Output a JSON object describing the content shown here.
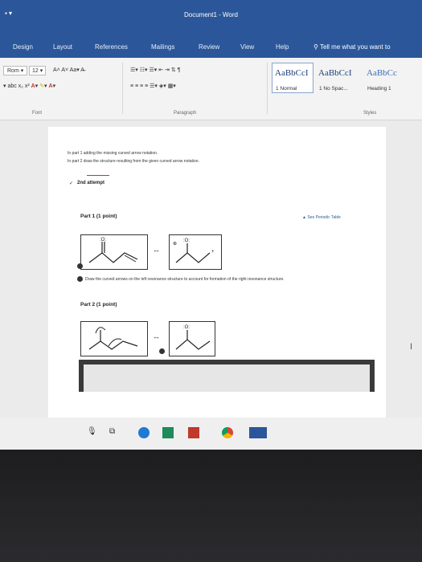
{
  "window": {
    "title": "Document1 - Word"
  },
  "tabs": [
    "Design",
    "Layout",
    "References",
    "Mailings",
    "Review",
    "View",
    "Help"
  ],
  "tell_me": "Tell me what you want to",
  "ribbon": {
    "font_name": "Rom",
    "font_size": "12",
    "groups": {
      "font": "Font",
      "paragraph": "Paragraph",
      "styles": "Styles"
    },
    "styles": [
      {
        "preview": "AaBbCcI",
        "name": "1 Normal"
      },
      {
        "preview": "AaBbCcI",
        "name": "1 No Spac..."
      },
      {
        "preview": "AaBbCc",
        "name": "Heading 1"
      }
    ]
  },
  "document": {
    "line1": "In part 1 adding the missing curved arrow notation.",
    "line2": "In part 2 draw the structure resulting from the given curved arrow notation.",
    "attempt": "2nd attempt",
    "part1_title": "Part 1 (1 point)",
    "periodic": "See Periodic Table",
    "instruction": "Draw the curved arrows on the left resonance structure to account for formation of the right resonance structure.",
    "part2_title": "Part 2 (1 point)"
  },
  "colors": {
    "word_blue": "#2b579a",
    "accent_red": "#c0392b"
  }
}
